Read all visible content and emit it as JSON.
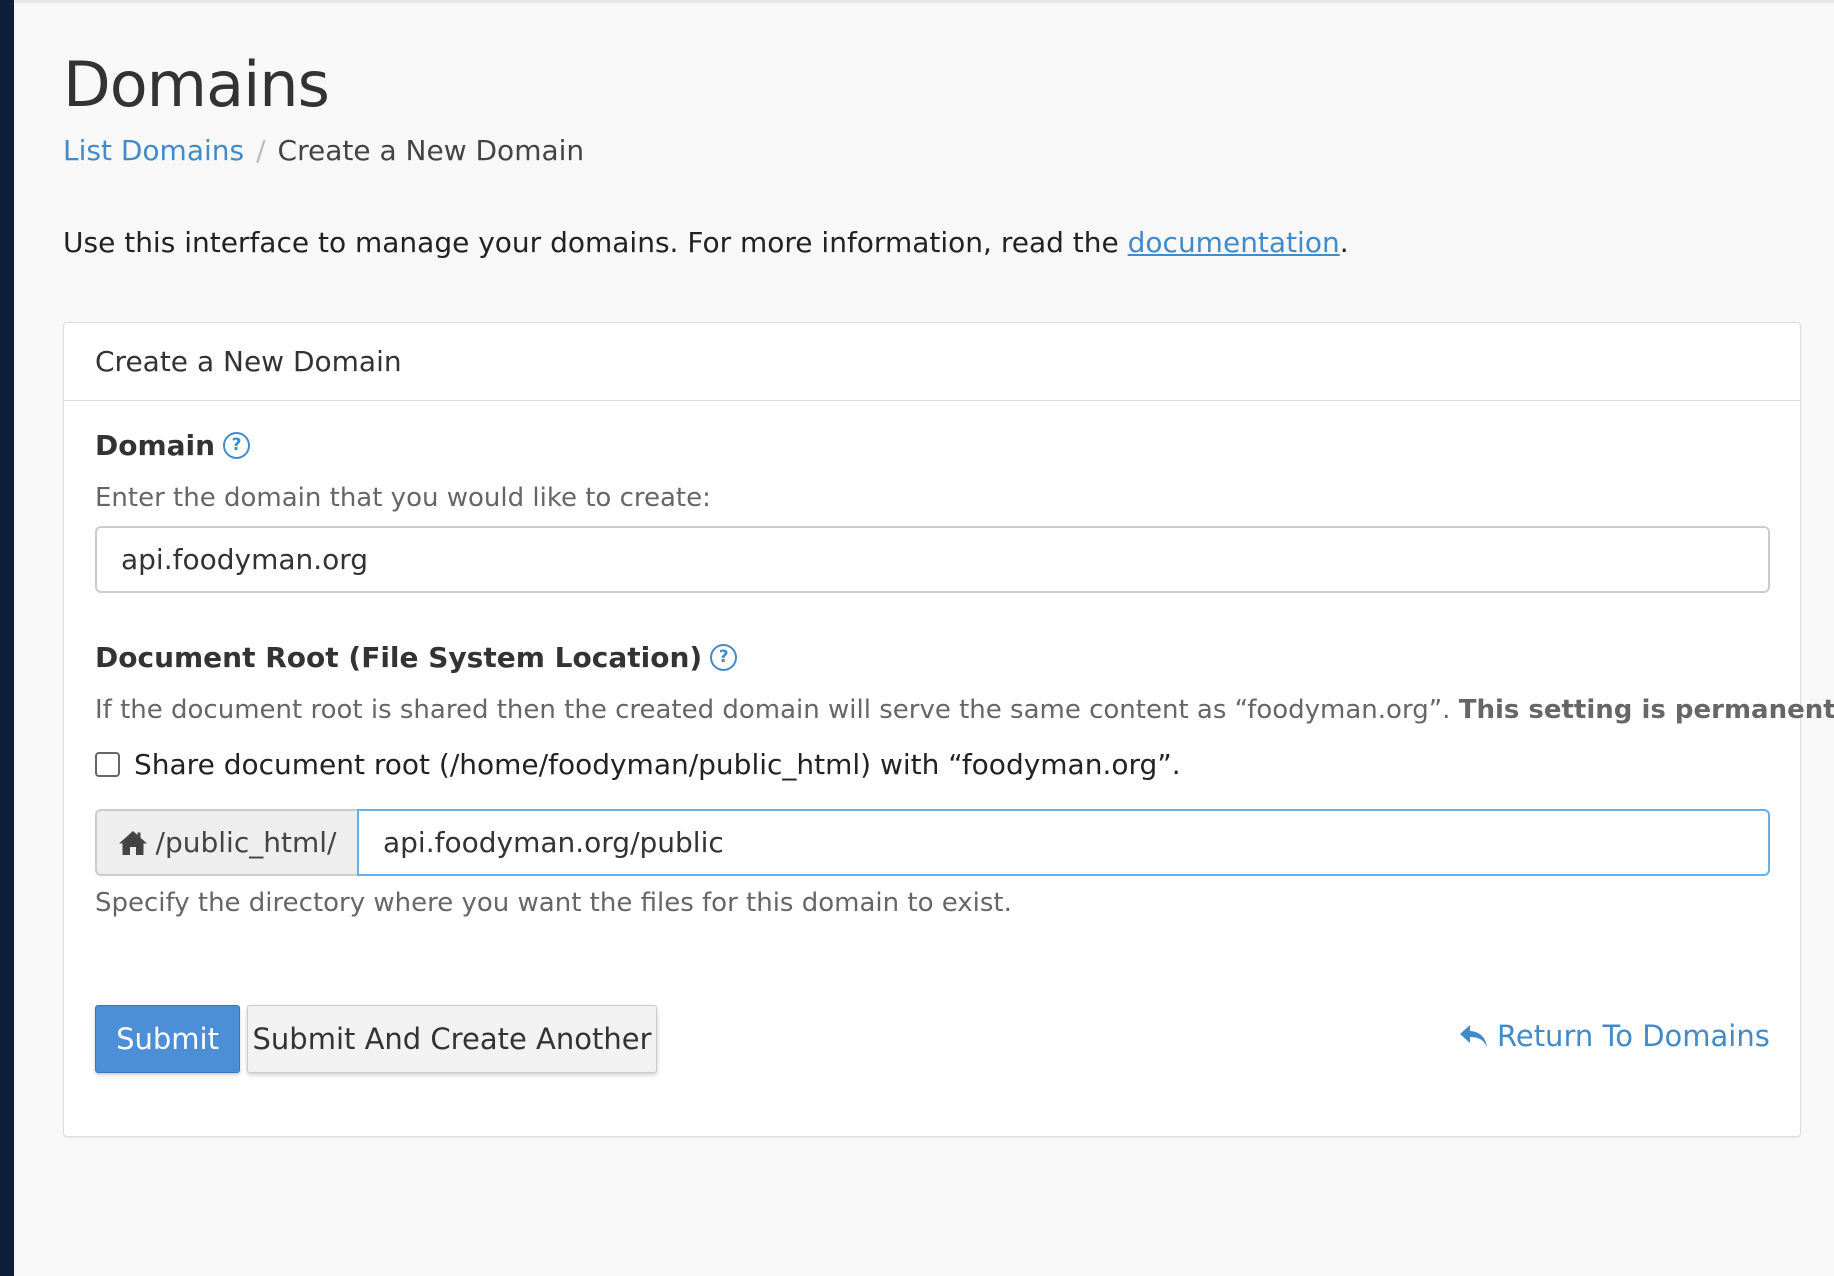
{
  "page": {
    "title": "Domains",
    "breadcrumb": {
      "link": "List Domains",
      "separator": "/",
      "current": "Create a New Domain"
    },
    "intro": {
      "text": "Use this interface to manage your domains. For more information, read the ",
      "link": "documentation",
      "suffix": "."
    }
  },
  "panel": {
    "heading": "Create a New Domain",
    "domain": {
      "label": "Domain",
      "help_icon": "?",
      "description": "Enter the domain that you would like to create:",
      "value": "api.foodyman.org"
    },
    "docroot": {
      "label": "Document Root (File System Location)",
      "help_icon": "?",
      "description": "If the document root is shared then the created domain will serve the same content as “foodyman.org”. ",
      "description_bold": "This setting is permanent.",
      "share_checkbox_label": "Share document root (/home/foodyman/public_html) with “foodyman.org”.",
      "share_checked": false,
      "prefix": "/public_html/",
      "value": "api.foodyman.org/public",
      "hint": "Specify the directory where you want the files for this domain to exist."
    },
    "actions": {
      "submit": "Submit",
      "submit_another": "Submit And Create Another",
      "return": "Return To Domains"
    }
  },
  "colors": {
    "link": "#428bca",
    "primary_button": "#4d8fd6",
    "sidebar": "#0f1f3a"
  },
  "icons": {
    "help": "question-circle-icon",
    "home": "home-icon",
    "return": "reply-arrow-icon"
  }
}
